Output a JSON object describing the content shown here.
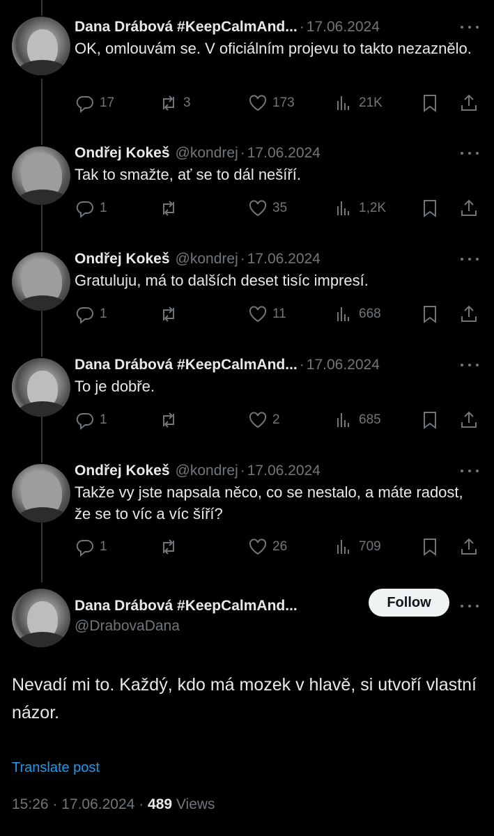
{
  "thread": [
    {
      "name": "Dana Drábová #KeepCalmAnd...",
      "handle": "",
      "date": "17.06.2024",
      "text": "OK, omlouvám se. V oficiálním projevu to takto nezaznělo.",
      "replies": "17",
      "reposts": "3",
      "likes": "173",
      "views": "21K"
    },
    {
      "name": "Ondřej Kokeš",
      "handle": "@kondrej",
      "date": "17.06.2024",
      "text": "Tak to smažte, ať se to dál nešíří.",
      "replies": "1",
      "reposts": "",
      "likes": "35",
      "views": "1,2K"
    },
    {
      "name": "Ondřej Kokeš",
      "handle": "@kondrej",
      "date": "17.06.2024",
      "text": "Gratuluju, má to dalších deset tisíc impresí.",
      "replies": "1",
      "reposts": "",
      "likes": "11",
      "views": "668"
    },
    {
      "name": "Dana Drábová #KeepCalmAnd...",
      "handle": "",
      "date": "17.06.2024",
      "text": "To je dobře.",
      "replies": "1",
      "reposts": "",
      "likes": "2",
      "views": "685"
    },
    {
      "name": "Ondřej Kokeš",
      "handle": "@kondrej",
      "date": "17.06.2024",
      "text": "Takže vy jste napsala něco, co se nestalo, a máte radost, že se to víc a víc šíří?",
      "replies": "1",
      "reposts": "",
      "likes": "26",
      "views": "709"
    }
  ],
  "main": {
    "name": "Dana Drábová #KeepCalmAnd...",
    "handle": "@DrabovaDana",
    "follow_label": "Follow",
    "text": "Nevadí mi to. Každý, kdo má mozek v hlavě, si utvoří vlastní názor.",
    "translate": "Translate post",
    "time": "15:26",
    "date": "17.06.2024",
    "views_count": "489",
    "views_label": "Views"
  },
  "icons": [
    "more-icon",
    "reply-icon",
    "repost-icon",
    "like-icon",
    "views-icon",
    "bookmark-icon",
    "share-icon"
  ],
  "colors": {
    "background": "#000000",
    "text": "#e7e9ea",
    "muted": "#71767b",
    "link": "#1d9bf0",
    "button": "#eff3f4"
  }
}
